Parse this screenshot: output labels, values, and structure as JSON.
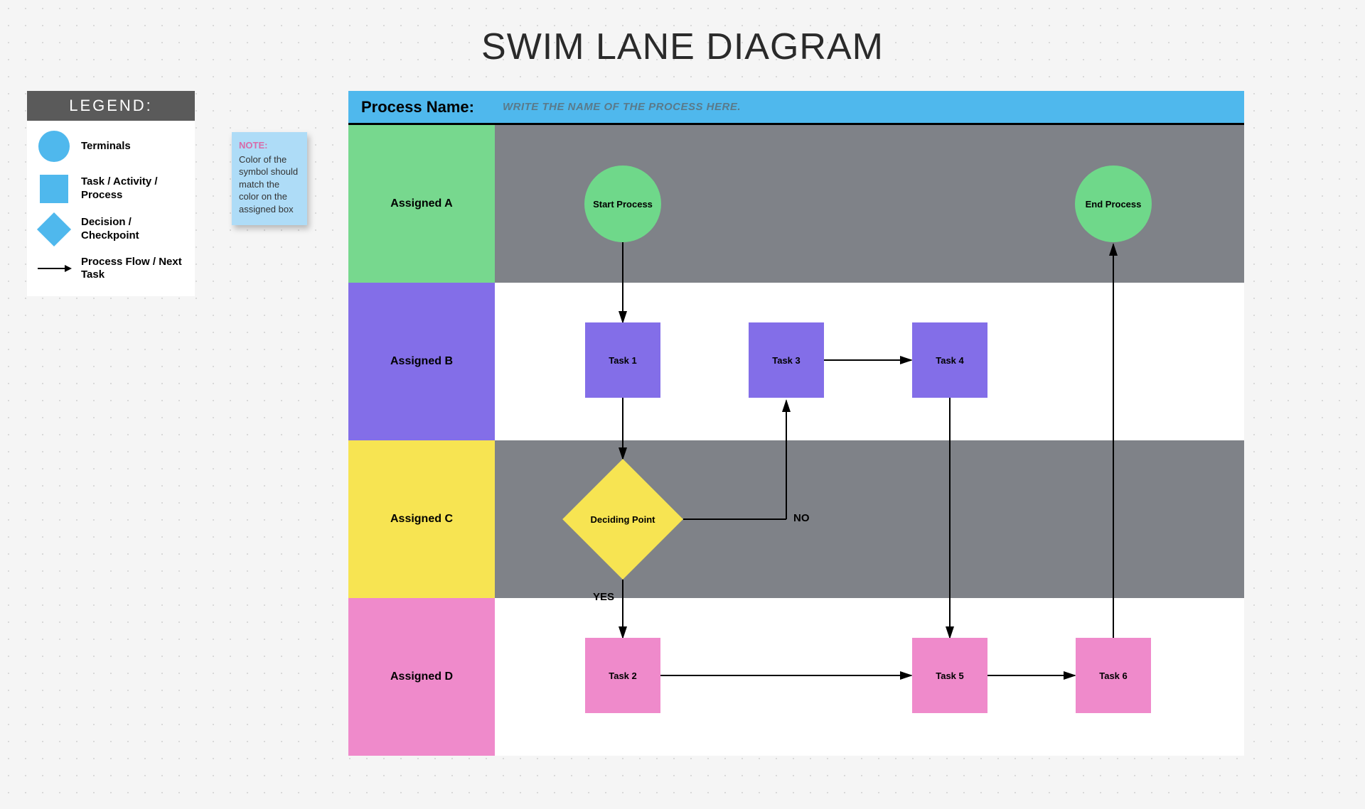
{
  "title": "SWIM LANE DIAGRAM",
  "legend": {
    "header": "LEGEND:",
    "items": {
      "terminals": "Terminals",
      "task": "Task / Activity / Process",
      "decision": "Decision / Checkpoint",
      "flow": "Process Flow / Next Task"
    }
  },
  "note": {
    "title": "NOTE:",
    "body": "Color of the symbol should match the color on the assigned box"
  },
  "process": {
    "name_label": "Process Name:",
    "name_placeholder": "WRITE THE NAME OF THE PROCESS HERE."
  },
  "lanes": {
    "a": "Assigned A",
    "b": "Assigned B",
    "c": "Assigned C",
    "d": "Assigned D"
  },
  "nodes": {
    "start": "Start Process",
    "end": "End Process",
    "task1": "Task 1",
    "task2": "Task 2",
    "task3": "Task 3",
    "task4": "Task 4",
    "task5": "Task 5",
    "task6": "Task 6",
    "decision": "Deciding Point"
  },
  "edges": {
    "yes": "YES",
    "no": "NO"
  },
  "colors": {
    "green": "#77d88e",
    "purple": "#836ee8",
    "yellow": "#f7e452",
    "pink": "#ef8acb",
    "blue": "#4fb8ed",
    "grey": "#7f8288"
  },
  "chart_data": {
    "type": "swimlane",
    "title": "SWIM LANE DIAGRAM",
    "lanes": [
      {
        "id": "A",
        "label": "Assigned A",
        "color": "#77d88e"
      },
      {
        "id": "B",
        "label": "Assigned B",
        "color": "#836ee8"
      },
      {
        "id": "C",
        "label": "Assigned C",
        "color": "#f7e452"
      },
      {
        "id": "D",
        "label": "Assigned D",
        "color": "#ef8acb"
      }
    ],
    "nodes": [
      {
        "id": "start",
        "label": "Start Process",
        "type": "terminal",
        "lane": "A"
      },
      {
        "id": "task1",
        "label": "Task 1",
        "type": "task",
        "lane": "B"
      },
      {
        "id": "decision",
        "label": "Deciding Point",
        "type": "decision",
        "lane": "C"
      },
      {
        "id": "task2",
        "label": "Task 2",
        "type": "task",
        "lane": "D"
      },
      {
        "id": "task3",
        "label": "Task 3",
        "type": "task",
        "lane": "B"
      },
      {
        "id": "task4",
        "label": "Task 4",
        "type": "task",
        "lane": "B"
      },
      {
        "id": "task5",
        "label": "Task 5",
        "type": "task",
        "lane": "D"
      },
      {
        "id": "task6",
        "label": "Task 6",
        "type": "task",
        "lane": "D"
      },
      {
        "id": "end",
        "label": "End Process",
        "type": "terminal",
        "lane": "A"
      }
    ],
    "edges": [
      {
        "from": "start",
        "to": "task1"
      },
      {
        "from": "task1",
        "to": "decision"
      },
      {
        "from": "decision",
        "to": "task3",
        "label": "NO"
      },
      {
        "from": "decision",
        "to": "task2",
        "label": "YES"
      },
      {
        "from": "task3",
        "to": "task4"
      },
      {
        "from": "task4",
        "to": "task5"
      },
      {
        "from": "task2",
        "to": "task5"
      },
      {
        "from": "task5",
        "to": "task6"
      },
      {
        "from": "task6",
        "to": "end"
      }
    ]
  }
}
